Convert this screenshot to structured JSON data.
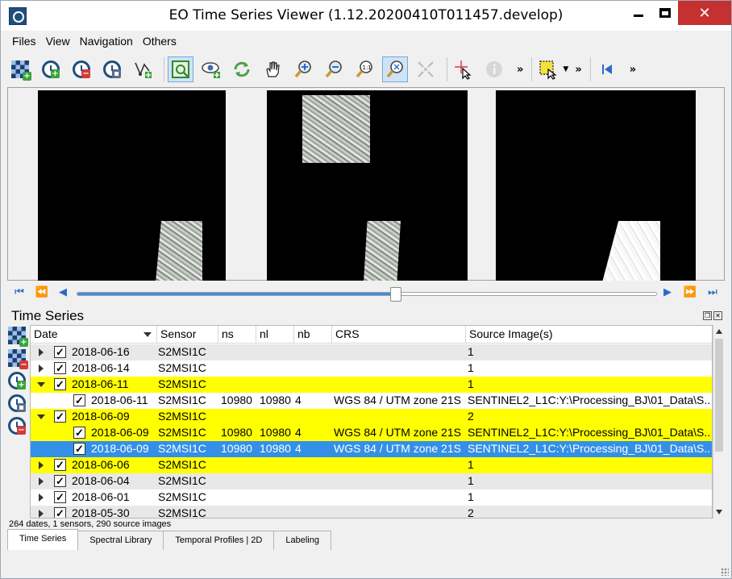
{
  "window": {
    "title": "EO Time Series Viewer (1.12.20200410T011457.develop)",
    "minimize": "minimize",
    "maximize": "maximize",
    "close": "✕"
  },
  "menu": [
    "Files",
    "View",
    "Navigation",
    "Others"
  ],
  "toolbar": {
    "icons": [
      "add-images-icon",
      "add-time-series-icon",
      "remove-time-series-icon",
      "save-time-series-icon",
      "add-vector-icon",
      "select-area-icon",
      "pan-to-icon",
      "refresh-icon",
      "pan-icon",
      "zoom-in-icon",
      "zoom-out-icon",
      "zoom-native-icon",
      "zoom-full-icon",
      "zoom-pixel-icon",
      "identify-cursor-icon",
      "info-icon",
      "select-feature-icon",
      "first-date-icon"
    ],
    "more": "»"
  },
  "navigation": {
    "slider_position": 0.55,
    "accent": "#3c8ce6"
  },
  "time_series": {
    "panel_title": "Time Series",
    "columns": [
      "Date",
      "Sensor",
      "ns",
      "nl",
      "nb",
      "CRS",
      "Source Image(s)"
    ],
    "rows": [
      {
        "level": 0,
        "expander": "collapsed",
        "checked": true,
        "date": "2018-06-16",
        "sensor": "S2MSI1C",
        "ns": "",
        "nl": "",
        "nb": "",
        "crs": "",
        "source": "1",
        "style": "alt"
      },
      {
        "level": 0,
        "expander": "collapsed",
        "checked": true,
        "date": "2018-06-14",
        "sensor": "S2MSI1C",
        "ns": "",
        "nl": "",
        "nb": "",
        "crs": "",
        "source": "1",
        "style": "plain"
      },
      {
        "level": 0,
        "expander": "expanded",
        "checked": true,
        "date": "2018-06-11",
        "sensor": "S2MSI1C",
        "ns": "",
        "nl": "",
        "nb": "",
        "crs": "",
        "source": "1",
        "style": "yellow"
      },
      {
        "level": 1,
        "expander": "none",
        "checked": true,
        "date": "2018-06-11",
        "sensor": "S2MSI1C",
        "ns": "10980",
        "nl": "10980",
        "nb": "4",
        "crs": "WGS 84 / UTM zone 21S",
        "source": "SENTINEL2_L1C:Y:\\Processing_BJ\\01_Data\\S...",
        "style": "plain"
      },
      {
        "level": 0,
        "expander": "expanded",
        "checked": true,
        "date": "2018-06-09",
        "sensor": "S2MSI1C",
        "ns": "",
        "nl": "",
        "nb": "",
        "crs": "",
        "source": "2",
        "style": "yellow"
      },
      {
        "level": 1,
        "expander": "none",
        "checked": true,
        "date": "2018-06-09",
        "sensor": "S2MSI1C",
        "ns": "10980",
        "nl": "10980",
        "nb": "4",
        "crs": "WGS 84 / UTM zone 21S",
        "source": "SENTINEL2_L1C:Y:\\Processing_BJ\\01_Data\\S...",
        "style": "yellow"
      },
      {
        "level": 1,
        "expander": "none",
        "checked": true,
        "date": "2018-06-09",
        "sensor": "S2MSI1C",
        "ns": "10980",
        "nl": "10980",
        "nb": "4",
        "crs": "WGS 84 / UTM zone 21S",
        "source": "SENTINEL2_L1C:Y:\\Processing_BJ\\01_Data\\S...",
        "style": "selected"
      },
      {
        "level": 0,
        "expander": "collapsed",
        "checked": true,
        "date": "2018-06-06",
        "sensor": "S2MSI1C",
        "ns": "",
        "nl": "",
        "nb": "",
        "crs": "",
        "source": "1",
        "style": "yellow"
      },
      {
        "level": 0,
        "expander": "collapsed",
        "checked": true,
        "date": "2018-06-04",
        "sensor": "S2MSI1C",
        "ns": "",
        "nl": "",
        "nb": "",
        "crs": "",
        "source": "1",
        "style": "alt"
      },
      {
        "level": 0,
        "expander": "collapsed",
        "checked": true,
        "date": "2018-06-01",
        "sensor": "S2MSI1C",
        "ns": "",
        "nl": "",
        "nb": "",
        "crs": "",
        "source": "1",
        "style": "plain"
      },
      {
        "level": 0,
        "expander": "collapsed",
        "checked": true,
        "date": "2018-05-30",
        "sensor": "S2MSI1C",
        "ns": "",
        "nl": "",
        "nb": "",
        "crs": "",
        "source": "2",
        "style": "alt"
      }
    ],
    "status": "264 dates, 1 sensors, 290 source images",
    "highlight_color": "#ffff00",
    "selection_color": "#3390e8"
  },
  "tabs": [
    "Time Series",
    "Spectral Library",
    "Temporal Profiles | 2D",
    "Labeling"
  ],
  "active_tab": "Time Series"
}
